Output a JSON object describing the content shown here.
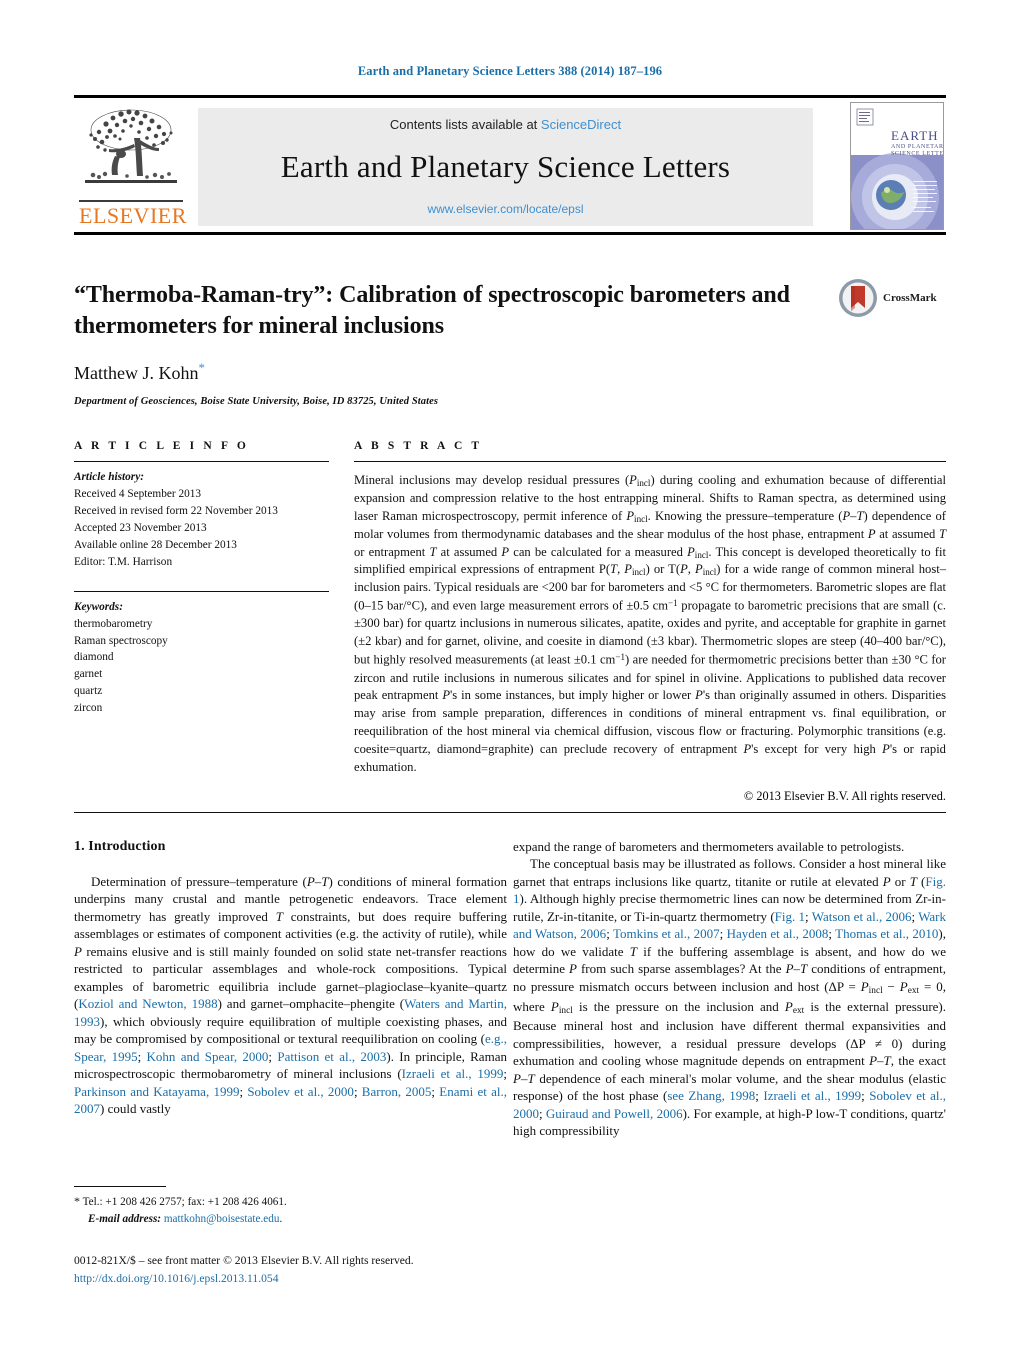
{
  "running_head": "Earth and Planetary Science Letters 388 (2014) 187–196",
  "masthead": {
    "contents_prefix": "Contents lists available at ",
    "sciencedirect": "ScienceDirect",
    "journal_title": "Earth and Planetary Science Letters",
    "url": "www.elsevier.com/locate/epsl",
    "publisher_wordmark": "ELSEVIER",
    "publisher_color": "#E87722",
    "link_color": "#3f8fcf",
    "cover": {
      "line1": "EARTH",
      "line2": "AND PLANETARY",
      "line3": "SCIENCE LETTERS"
    }
  },
  "article": {
    "title": "“Thermoba-Raman-try”: Calibration of spectroscopic barometers and thermometers for mineral inclusions",
    "author": "Matthew J. Kohn",
    "author_marker": "*",
    "affiliation": "Department of Geosciences, Boise State University, Boise, ID 83725, United States",
    "crossmark_label": "CrossMark"
  },
  "info": {
    "heading": "A R T I C L E   I N F O",
    "history_label": "Article history:",
    "history": [
      "Received 4 September 2013",
      "Received in revised form 22 November 2013",
      "Accepted 23 November 2013",
      "Available online 28 December 2013",
      "Editor: T.M. Harrison"
    ],
    "keywords_label": "Keywords:",
    "keywords": [
      "thermobarometry",
      "Raman spectroscopy",
      "diamond",
      "garnet",
      "quartz",
      "zircon"
    ]
  },
  "abstract": {
    "heading": "A B S T R A C T",
    "text_part1": "Mineral inclusions may develop residual pressures (P",
    "copyright": "© 2013 Elsevier B.V. All rights reserved.",
    "paragraph": "Mineral inclusions may develop residual pressures (Pincl) during cooling and exhumation because of differential expansion and compression relative to the host entrapping mineral. Shifts to Raman spectra, as determined using laser Raman microspectroscopy, permit inference of Pincl. Knowing the pressure–temperature (P–T) dependence of molar volumes from thermodynamic databases and the shear modulus of the host phase, entrapment P at assumed T or entrapment T at assumed P can be calculated for a measured Pincl. This concept is developed theoretically to fit simplified empirical expressions of entrapment P(T, Pincl) or T(P, Pincl) for a wide range of common mineral host–inclusion pairs. Typical residuals are <200 bar for barometers and <5 °C for thermometers. Barometric slopes are flat (0–15 bar/°C), and even large measurement errors of ±0.5 cm−1 propagate to barometric precisions that are small (c. ±300 bar) for quartz inclusions in numerous silicates, apatite, oxides and pyrite, and acceptable for graphite in garnet (±2 kbar) and for garnet, olivine, and coesite in diamond (±3 kbar). Thermometric slopes are steep (40–400 bar/°C), but highly resolved measurements (at least ±0.1 cm−1) are needed for thermometric precisions better than ±30 °C for zircon and rutile inclusions in numerous silicates and for spinel in olivine. Applications to published data recover peak entrapment P's in some instances, but imply higher or lower P's than originally assumed in others. Disparities may arise from sample preparation, differences in conditions of mineral entrapment vs. final equilibration, or reequilibration of the host mineral via chemical diffusion, viscous flow or fracturing. Polymorphic transitions (e.g. coesite=quartz, diamond=graphite) can preclude recovery of entrapment P's except for very high P's or rapid exhumation."
  },
  "body": {
    "section_heading": "1. Introduction",
    "left_paragraph_1": "Determination of pressure–temperature (P–T) conditions of mineral formation underpins many crustal and mantle petrogenetic endeavors. Trace element thermometry has greatly improved T constraints, but does require buffering assemblages or estimates of component activities (e.g. the activity of rutile), while P remains elusive and is still mainly founded on solid state net-transfer reactions restricted to particular assemblages and whole-rock compositions. Typical examples of barometric equilibria include garnet–plagioclase–kyanite–quartz (Koziol and Newton, 1988) and garnet–omphacite–phengite (Waters and Martin, 1993), which obviously require equilibration of multiple coexisting phases, and may be compromised by compositional or textural reequilibration on cooling (e.g., Spear, 1995; Kohn and Spear, 2000; Pattison et al., 2003). In principle, Raman microspectroscopic thermobarometry of mineral inclusions (Izraeli et al., 1999; Parkinson and Katayama, 1999; Sobolev et al., 2000; Barron, 2005; Enami et al., 2007) could vastly",
    "right_paragraph_1": "expand the range of barometers and thermometers available to petrologists.",
    "right_paragraph_2": "The conceptual basis may be illustrated as follows. Consider a host mineral like garnet that entraps inclusions like quartz, titanite or rutile at elevated P or T (Fig. 1). Although highly precise thermometric lines can now be determined from Zr-in-rutile, Zr-in-titanite, or Ti-in-quartz thermometry (Fig. 1; Watson et al., 2006; Wark and Watson, 2006; Tomkins et al., 2007; Hayden et al., 2008; Thomas et al., 2010), how do we validate T if the buffering assemblage is absent, and how do we determine P from such sparse assemblages? At the P–T conditions of entrapment, no pressure mismatch occurs between inclusion and host (ΔP = Pincl − Pext = 0, where Pincl is the pressure on the inclusion and Pext is the external pressure). Because mineral host and inclusion have different thermal expansivities and compressibilities, however, a residual pressure develops (ΔP ≠ 0) during exhumation and cooling whose magnitude depends on entrapment P–T, the exact P–T dependence of each mineral's molar volume, and the shear modulus (elastic response) of the host phase (see Zhang, 1998; Izraeli et al., 1999; Sobolev et al., 2000; Guiraud and Powell, 2006). For example, at high-P low-T conditions, quartz' high compressibility",
    "citation_color": "#1a6ea8"
  },
  "footnote": {
    "marker": "*",
    "tel_line": "Tel.: +1 208 426 2757; fax: +1 208 426 4061.",
    "email_label": "E-mail address:",
    "email": "mattkohn@boisestate.edu",
    "period": "."
  },
  "imprint": {
    "line1": "0012-821X/$ – see front matter © 2013 Elsevier B.V. All rights reserved.",
    "doi": "http://dx.doi.org/10.1016/j.epsl.2013.11.054"
  }
}
